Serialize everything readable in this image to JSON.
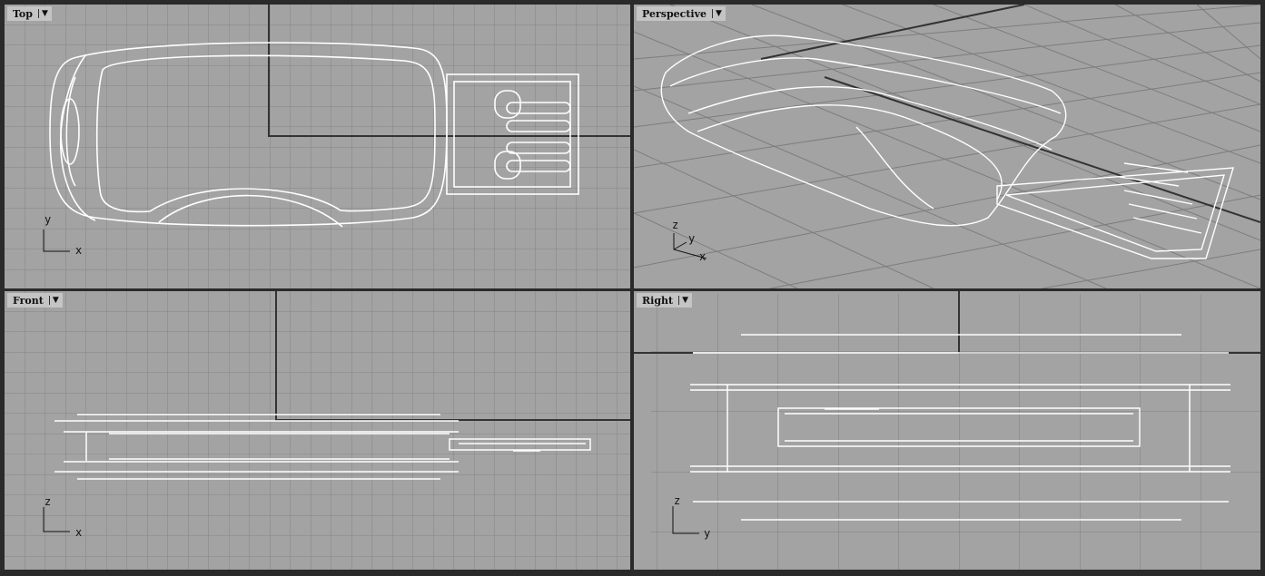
{
  "viewports": {
    "top": {
      "label": "Top",
      "axes": [
        "y",
        "x"
      ]
    },
    "perspective": {
      "label": "Perspective",
      "axes": [
        "z",
        "y",
        "x"
      ]
    },
    "front": {
      "label": "Front",
      "axes": [
        "z",
        "x"
      ]
    },
    "right": {
      "label": "Right",
      "axes": [
        "z",
        "y"
      ]
    }
  },
  "icons": {
    "dropdown": "triangle-down-icon"
  },
  "dropdown_glyph": "▼",
  "colors": {
    "viewport_bg": "#a3a3a3",
    "grid": "#8a8a8a",
    "curves": "#ffffff",
    "frame": "#2a2a2a"
  }
}
